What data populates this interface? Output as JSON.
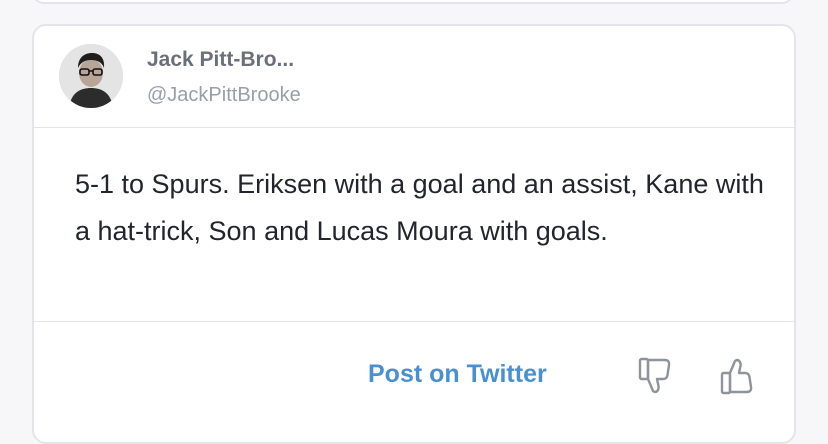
{
  "author": {
    "name": "Jack Pitt-Bro...",
    "handle": "@JackPittBrooke"
  },
  "tweet": {
    "text": "5-1 to Spurs. Eriksen with a goal and an assist, Kane with a hat-trick, Son and Lucas Moura with goals."
  },
  "actions": {
    "post_label": "Post on Twitter",
    "thumbs_down_icon": "thumbs-down-icon",
    "thumbs_up_icon": "thumbs-up-icon"
  },
  "colors": {
    "link": "#4a8fcf",
    "border": "#e3e5ea",
    "text": "#22252b",
    "muted": "#9a9ea8",
    "icon": "#8e939c"
  }
}
